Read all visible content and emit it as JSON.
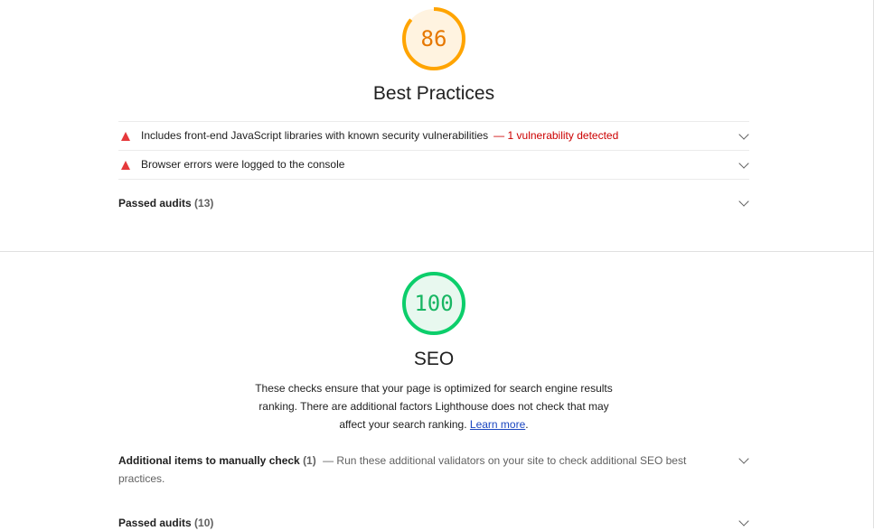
{
  "best_practices": {
    "score": "86",
    "score_fraction": 0.86,
    "score_color": "#ffa400",
    "score_bg": "#fff3e0",
    "title": "Best Practices",
    "audits": [
      {
        "label": "Includes front-end JavaScript libraries with known security vulnerabilities",
        "separator": "—",
        "detail": "1 vulnerability detected",
        "icon": "warning-triangle-icon"
      },
      {
        "label": "Browser errors were logged to the console",
        "separator": "",
        "detail": "",
        "icon": "warning-triangle-icon"
      }
    ],
    "passed": {
      "label": "Passed audits",
      "count": "(13)"
    }
  },
  "seo": {
    "score": "100",
    "score_fraction": 1.0,
    "score_color": "#0cce6b",
    "score_bg": "#e8f8ef",
    "title": "SEO",
    "description": "These checks ensure that your page is optimized for search engine results ranking. There are additional factors Lighthouse does not check that may affect your search ranking.",
    "learn_more": "Learn more",
    "period": ".",
    "manual": {
      "label": "Additional items to manually check",
      "count": "(1)",
      "separator": "—",
      "description": "Run these additional validators on your site to check additional SEO best practices."
    },
    "passed": {
      "label": "Passed audits",
      "count": "(10)"
    }
  },
  "colors": {
    "fail": "#e5393b",
    "fail_text": "#cc0000",
    "link": "#1a46c0",
    "divider": "#e0e0e0"
  }
}
